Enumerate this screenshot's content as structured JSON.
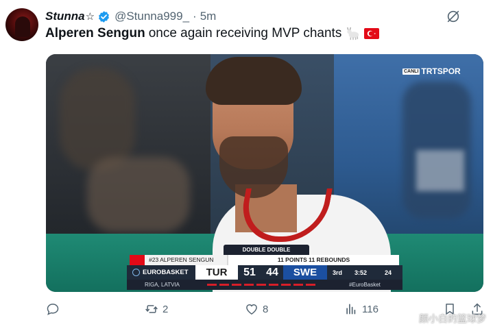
{
  "header": {
    "display_name": "Stunna",
    "star": "☆",
    "handle": "@Stunna999_",
    "dot": "·",
    "time": "5m"
  },
  "tweet": {
    "bold_text": "Alperen Sengun",
    "text": "once again receiving MVP chants"
  },
  "media": {
    "broadcaster_tag": "CANLI",
    "broadcaster": "TRTSPOR",
    "scoreboard": {
      "banner": "DOUBLE DOUBLE",
      "player": "#23 ALPEREN SENGUN",
      "stats": "11 POINTS  11 REBOUNDS",
      "league": "EUROBASKET",
      "home_team": "TUR",
      "home_score": "51",
      "away_score": "44",
      "away_team": "SWE",
      "period": "3rd",
      "clock": "3:52",
      "shot_clock": "24",
      "location": "RIGA, LATVIA",
      "hashtag": "#EuroBasket"
    }
  },
  "actions": {
    "replies": "",
    "reposts": "2",
    "likes": "8",
    "views": "116"
  },
  "watermark": "颜小白的篮球梦",
  "colors": {
    "verified": "#1d9bf0",
    "muted": "#536471",
    "turkey_red": "#e30a17"
  }
}
